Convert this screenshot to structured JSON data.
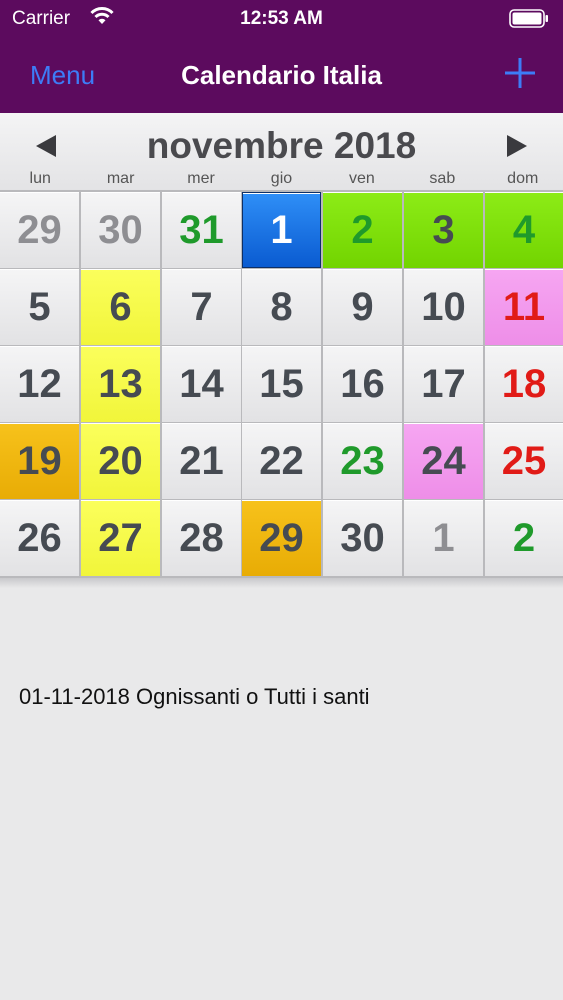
{
  "status_bar": {
    "carrier": "Carrier",
    "time": "12:53 AM"
  },
  "nav": {
    "menu_label": "Menu",
    "title": "Calendario Italia",
    "add_icon": "plus-icon"
  },
  "calendar": {
    "month_label": "novembre 2018",
    "weekdays": [
      "lun",
      "mar",
      "mer",
      "gio",
      "ven",
      "sab",
      "dom"
    ],
    "days": [
      [
        "29",
        "30",
        "31",
        "1",
        "2",
        "3",
        "4"
      ],
      [
        "5",
        "6",
        "7",
        "8",
        "9",
        "10",
        "11"
      ],
      [
        "12",
        "13",
        "14",
        "15",
        "16",
        "17",
        "18"
      ],
      [
        "19",
        "20",
        "21",
        "22",
        "23",
        "24",
        "25"
      ],
      [
        "26",
        "27",
        "28",
        "29",
        "30",
        "1",
        "2"
      ]
    ]
  },
  "selected_event": "01-11-2018 Ognissanti o Tutti i santi",
  "colors": {
    "nav_background": "#5c0b5e",
    "menu_text": "#3d7cf7",
    "today": "#1672e6",
    "holiday_green": "#1f9a2b",
    "sunday_red": "#e11b17"
  }
}
